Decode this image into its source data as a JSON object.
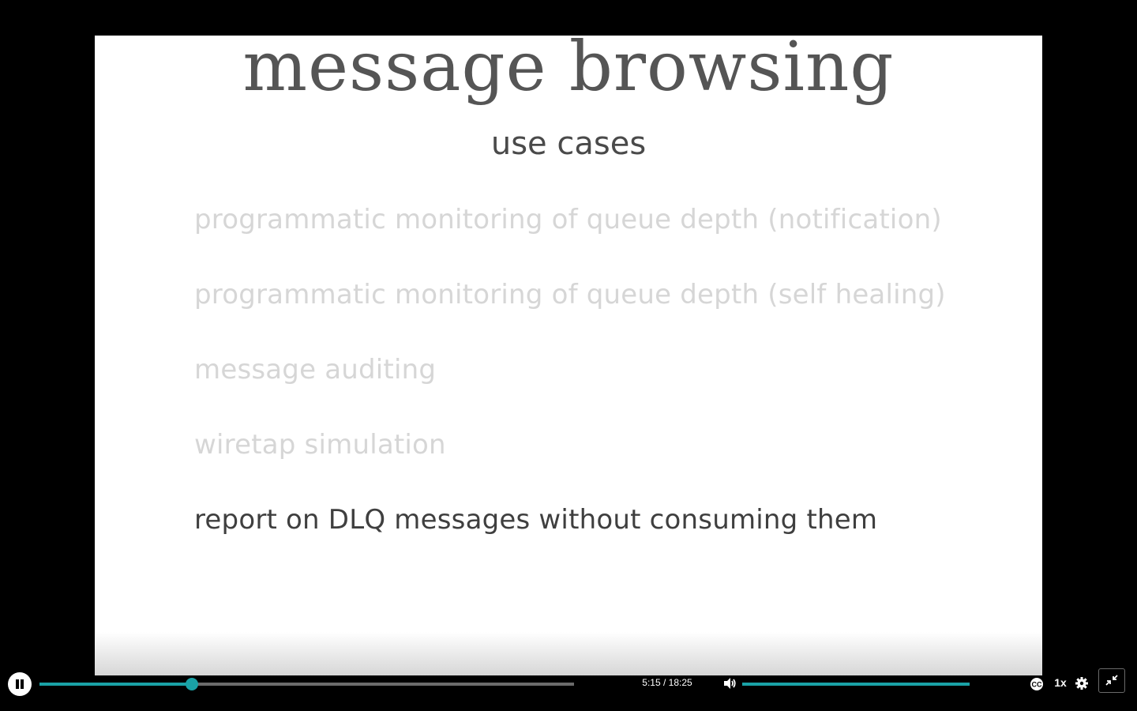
{
  "slide": {
    "title": "message browsing",
    "subtitle": "use cases",
    "use_cases": [
      {
        "text": "programmatic monitoring of queue depth (notification)",
        "state": "faded"
      },
      {
        "text": "programmatic monitoring of queue depth (self healing)",
        "state": "faded"
      },
      {
        "text": "message auditing",
        "state": "faded"
      },
      {
        "text": "wiretap simulation",
        "state": "faded"
      },
      {
        "text": "report on DLQ messages without consuming them",
        "state": "active"
      }
    ]
  },
  "player": {
    "state": "playing",
    "current_time": "5:15",
    "duration": "18:25",
    "time_display": "5:15 / 18:25",
    "progress_fraction": 0.285,
    "volume_fraction": 1.0,
    "speed_label": "1x",
    "icons": {
      "play_pause": "pause-icon",
      "volume": "volume-icon",
      "captions": "closed-captions-icon",
      "settings": "gear-icon",
      "fullscreen": "exit-fullscreen-icon"
    },
    "accent_color": "#1aa2a6"
  }
}
